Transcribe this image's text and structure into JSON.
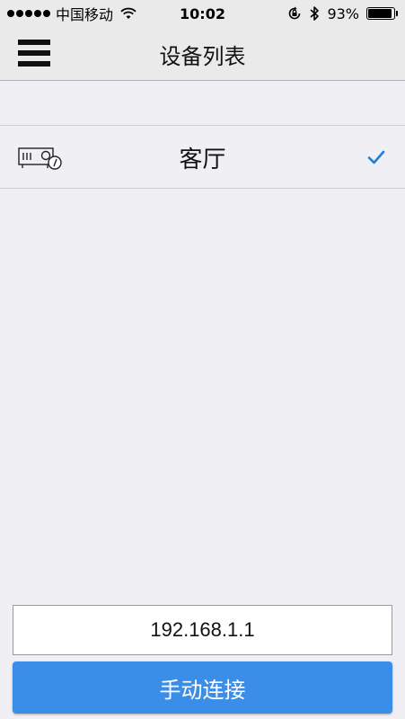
{
  "status_bar": {
    "carrier": "中国移动",
    "time": "10:02",
    "battery_percent_label": "93%",
    "battery_level": 0.93,
    "icons": [
      "signal-dots",
      "wifi-icon",
      "orientation-lock-icon",
      "bluetooth-icon",
      "battery-icon"
    ]
  },
  "nav": {
    "title": "设备列表",
    "menu_icon": "hamburger-menu-icon"
  },
  "devices": [
    {
      "name": "客厅",
      "icon": "projector-icon",
      "selected": true
    }
  ],
  "connect": {
    "ip_value": "192.168.1.1",
    "button_label": "手动连接"
  },
  "colors": {
    "accent": "#3a8ee8",
    "check": "#1a7fe0",
    "background": "#efeff4",
    "bar_background": "#eaeaea"
  }
}
